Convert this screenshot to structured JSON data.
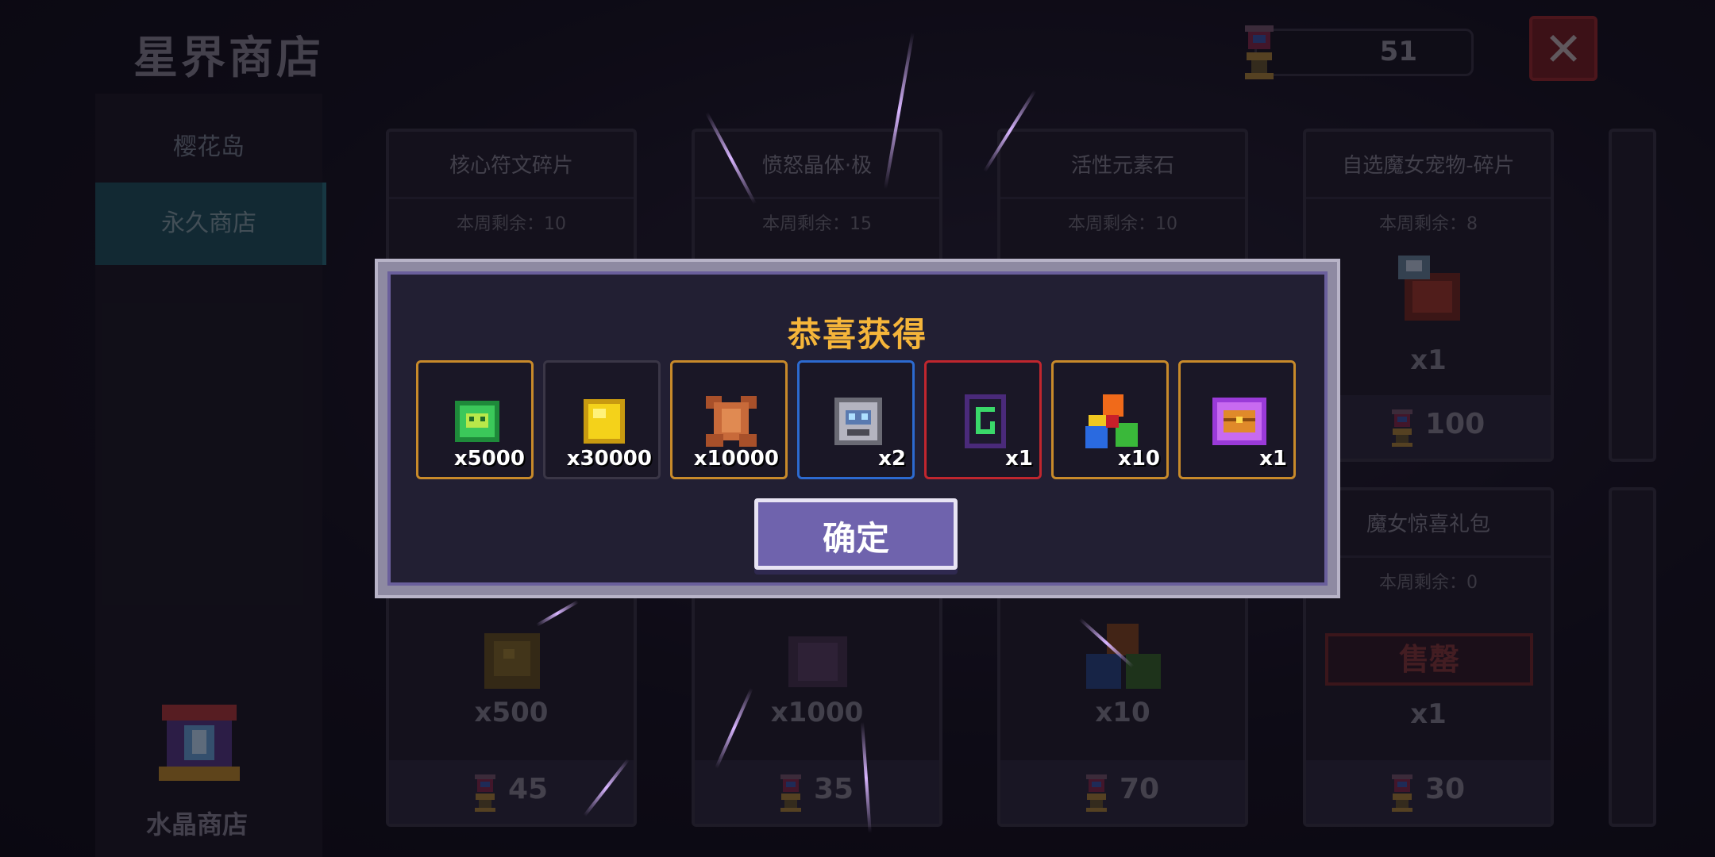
{
  "header": {
    "title": "星界商店",
    "currency_value": "51",
    "close_label": "✕"
  },
  "sidebar": {
    "items": [
      {
        "label": "樱花岛"
      },
      {
        "label": "永久商店"
      }
    ],
    "bottom_label": "水晶商店"
  },
  "shop": {
    "cards_top": [
      {
        "name": "核心符文碎片",
        "remain": "本周剩余：10"
      },
      {
        "name": "愤怒晶体·极",
        "remain": "本周剩余：15"
      },
      {
        "name": "活性元素石",
        "remain": "本周剩余：10"
      },
      {
        "name": "自选魔女宠物-碎片",
        "remain": "本周剩余：8",
        "qty": "x1",
        "price": "100"
      }
    ],
    "cards_bottom": [
      {
        "qty": "x500",
        "price": "45"
      },
      {
        "qty": "x1000",
        "price": "35"
      },
      {
        "qty": "x10",
        "price": "70"
      },
      {
        "name": "魔女惊喜礼包",
        "remain": "本周剩余：0",
        "soldout": "售罄",
        "qty": "x1",
        "price": "30"
      }
    ]
  },
  "modal": {
    "title": "恭喜获得",
    "rewards": [
      {
        "icon": "green-cat-coin-icon",
        "count": "x5000",
        "border": "#c88a2a"
      },
      {
        "icon": "gold-coin-icon",
        "count": "x30000",
        "border": "#3a3646"
      },
      {
        "icon": "leather-hide-icon",
        "count": "x10000",
        "border": "#c88a2a"
      },
      {
        "icon": "robot-orb-icon",
        "count": "x2",
        "border": "#2c6ad0"
      },
      {
        "icon": "green-rune-card-icon",
        "count": "x1",
        "border": "#c0262e"
      },
      {
        "icon": "elemental-gems-icon",
        "count": "x10",
        "border": "#c88a2a"
      },
      {
        "icon": "purple-chest-orb-icon",
        "count": "x1",
        "border": "#c88a2a"
      }
    ],
    "confirm_label": "确定"
  },
  "colors": {
    "accent_gold": "#f5b53a",
    "confirm_button": "#6f63ad",
    "close_red": "#7c1f22"
  }
}
